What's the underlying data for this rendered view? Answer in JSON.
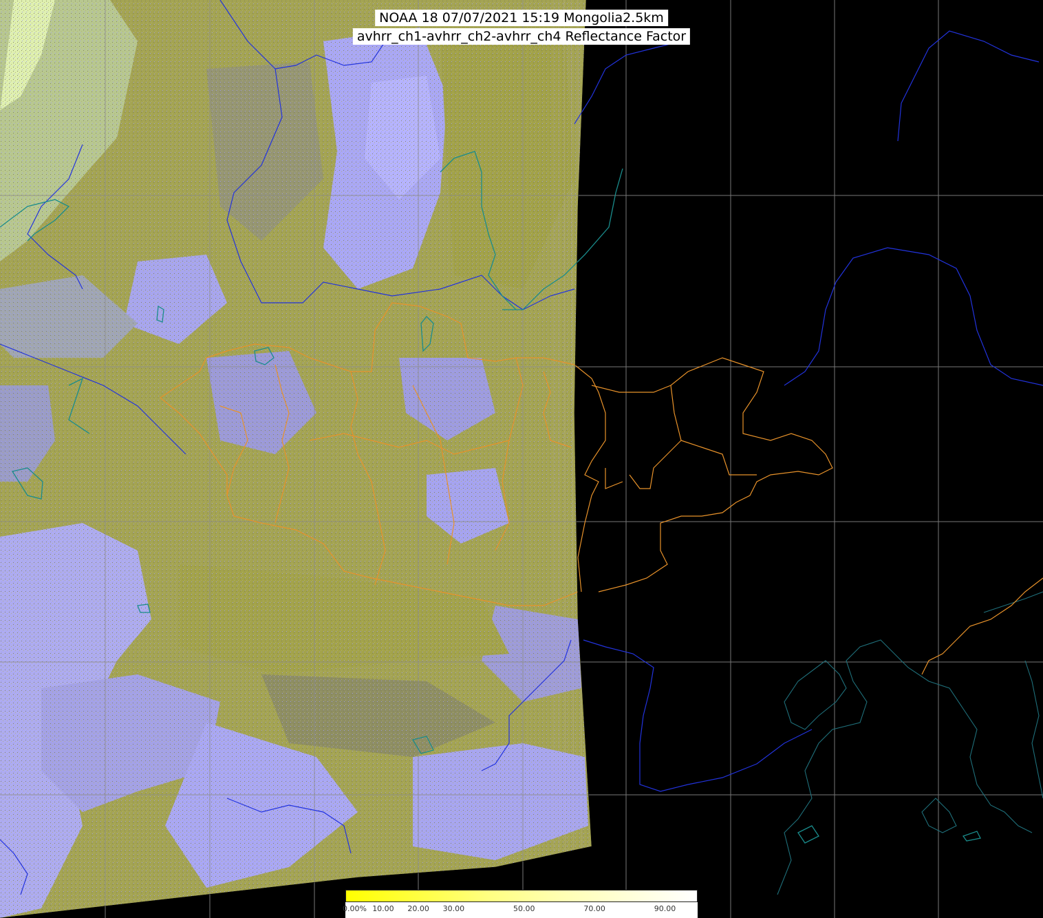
{
  "header": {
    "title_line1": "NOAA 18 07/07/2021 15:19 Mongolia2.5km",
    "title_line2": "avhrr_ch1-avhrr_ch2-avhrr_ch4 Reflectance Factor"
  },
  "colorbar": {
    "ticks": [
      {
        "label": "0.00%",
        "value": 0
      },
      {
        "label": "10.00",
        "value": 10
      },
      {
        "label": "20.00",
        "value": 20
      },
      {
        "label": "30.00",
        "value": 30
      },
      {
        "label": "50.00",
        "value": 50
      },
      {
        "label": "70.00",
        "value": 70
      },
      {
        "label": "90.00",
        "value": 90
      }
    ],
    "colors": [
      "#ffff00",
      "#ffff40",
      "#ffff80",
      "#ffffb0",
      "#ffffd8",
      "#ffffff"
    ]
  },
  "colors": {
    "background": "#000000",
    "imagery_olive": "#a8a848",
    "imagery_lavender": "#a9a7ff",
    "imagery_gray": "#8a8a6a",
    "gridline": "#8c8c8c",
    "coastline": "#2233cc",
    "lakes_rivers": "#1a8a8a",
    "province_borders": "#e8922a"
  }
}
